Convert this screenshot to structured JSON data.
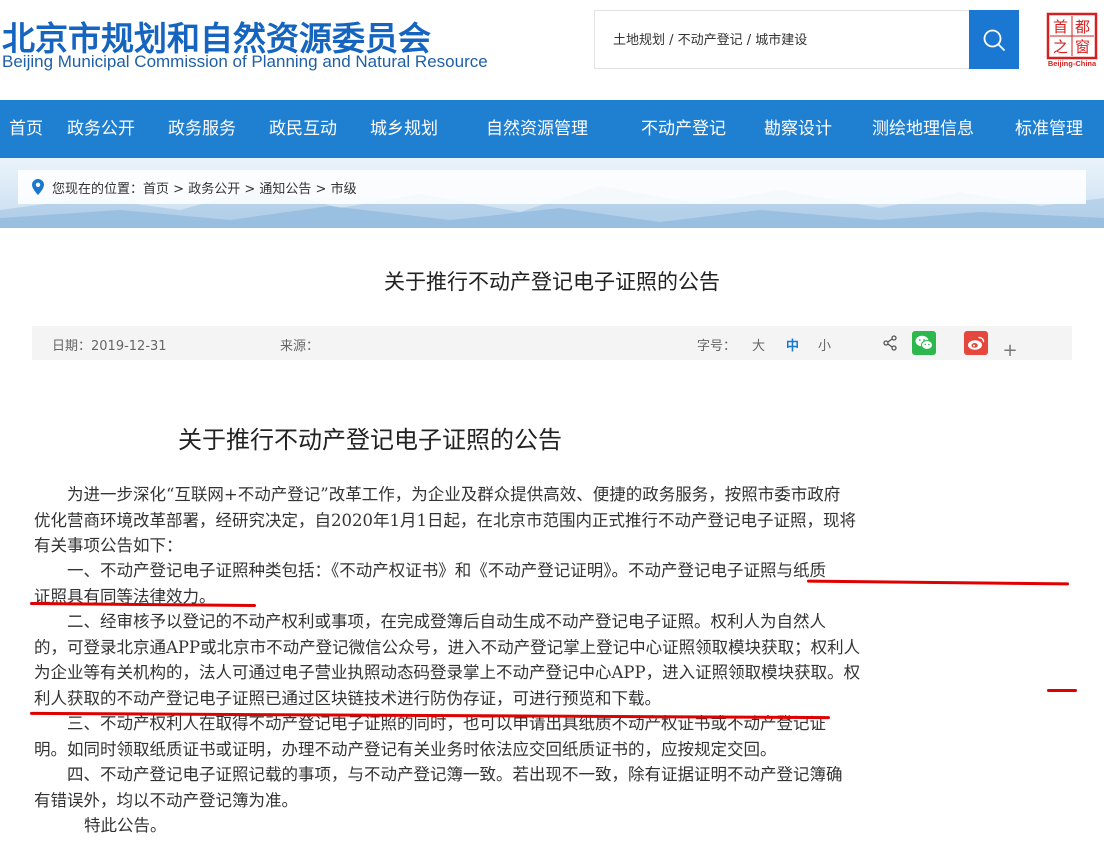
{
  "header": {
    "brand_cn": "北京市规划和自然资源委员会",
    "brand_en": "Beijing Municipal Commission of Planning and Natural Resource",
    "search_placeholder": "土地规划 / 不动产登记 / 城市建设",
    "seal_chars": [
      "首",
      "都",
      "之",
      "窗"
    ],
    "seal_caption": "Beijing-China"
  },
  "nav": {
    "items": [
      "首页",
      "政务公开",
      "政务服务",
      "政民互动",
      "城乡规划",
      "自然资源管理",
      "不动产登记",
      "勘察设计",
      "测绘地理信息",
      "标准管理"
    ]
  },
  "breadcrumb": {
    "prefix": "您现在的位置：",
    "items": [
      "首页",
      "政务公开",
      "通知公告",
      "市级"
    ],
    "separator": " > "
  },
  "article": {
    "title": "关于推行不动产登记电子证照的公告",
    "date_label": "日期：2019-12-31",
    "source_label": "来源：",
    "font_size_label": "字号：",
    "font_sizes": [
      "大",
      "中",
      "小"
    ],
    "body_title": "关于推行不动产登记电子证照的公告",
    "paragraphs": [
      [
        "为进一步深化“互联网+不动产登记”改革工作，为企业及群众提供高效、便捷的政务服务，按照市委市政府",
        "优化营商环境改革部署，经研究决定，自2020年1月1日起，在北京市范围内正式推行不动产登记电子证照，现将",
        "有关事项公告如下："
      ],
      [
        "一、不动产登记电子证照种类包括：《不动产权证书》和《不动产登记证明》。不动产登记电子证照与纸质",
        "证照具有同等法律效力。"
      ],
      [
        "二、经审核予以登记的不动产权利或事项，在完成登簿后自动生成不动产登记电子证照。权利人为自然人",
        "的，可登录北京通APP或北京市不动产登记微信公众号，进入不动产登记掌上登记中心证照领取模块获取；权利人",
        "为企业等有关机构的，法人可通过电子营业执照动态码登录掌上不动产登记中心APP，进入证照领取模块获取。权",
        "利人获取的不动产登记电子证照已通过区块链技术进行防伪存证，可进行预览和下载。"
      ],
      [
        "三、不动产权利人在取得不动产登记电子证照的同时，也可以申请出具纸质不动产权证书或不动产登记证",
        "明。如同时领取纸质证书或证明，办理不动产登记有关业务时依法应交回纸质证书的，应按规定交回。"
      ],
      [
        "四、不动产登记电子证照记载的事项，与不动产登记簿一致。若出现不一致，除有证据证明不动产登记簿确",
        "有错误外，均以不动产登记簿为准。"
      ],
      [
        "特此公告。"
      ]
    ]
  },
  "colors": {
    "brand_blue": "#1565c0",
    "nav_blue": "#1f7fd0",
    "search_blue": "#1a78d2",
    "highlight_red": "#e00000",
    "wechat_green": "#2db84d",
    "weibo_red": "#e6473d"
  },
  "icons": [
    "search-icon",
    "location-pin-icon",
    "share-icon",
    "wechat-icon",
    "weibo-icon",
    "plus-icon"
  ]
}
